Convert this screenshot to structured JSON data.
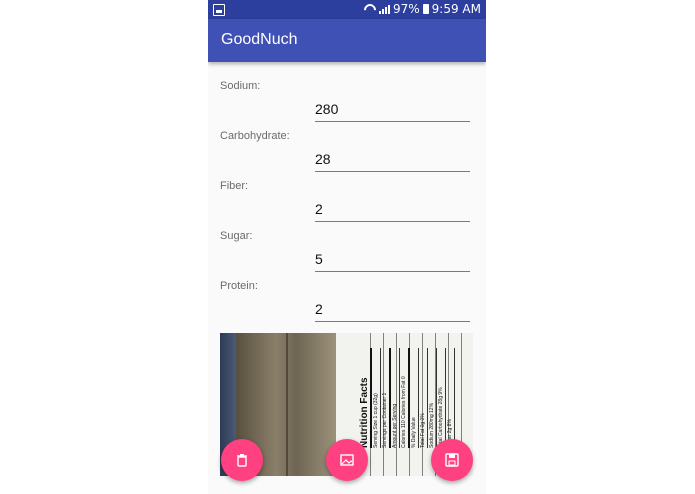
{
  "status_bar": {
    "battery": "97%",
    "time": "9:59 AM"
  },
  "app_title": "GoodNuch",
  "fields": [
    {
      "label": "Sodium:",
      "value": "280"
    },
    {
      "label": "Carbohydrate:",
      "value": "28"
    },
    {
      "label": "Fiber:",
      "value": "2"
    },
    {
      "label": "Sugar:",
      "value": "5"
    },
    {
      "label": "Protein:",
      "value": "2"
    }
  ],
  "photo": {
    "label_title": "Nutrition Facts",
    "lines": [
      "Serving Size 1 cup (32g)",
      "Servings per Container 1",
      "Amount per Serving",
      "Calories 110   Calories from Fat 0",
      "% Daily Value",
      "Total Fat 0g   0%",
      "Sodium 280mg   12%",
      "Total Carbohydrate 28g   9%",
      "Sugar 2g   8%"
    ]
  },
  "fabs": {
    "delete_icon": "trash-icon",
    "gallery_icon": "image-icon",
    "save_icon": "save-icon"
  },
  "colors": {
    "status_bar": "#2c3f9f",
    "app_bar": "#3f51b5",
    "fab": "#ff4081"
  }
}
